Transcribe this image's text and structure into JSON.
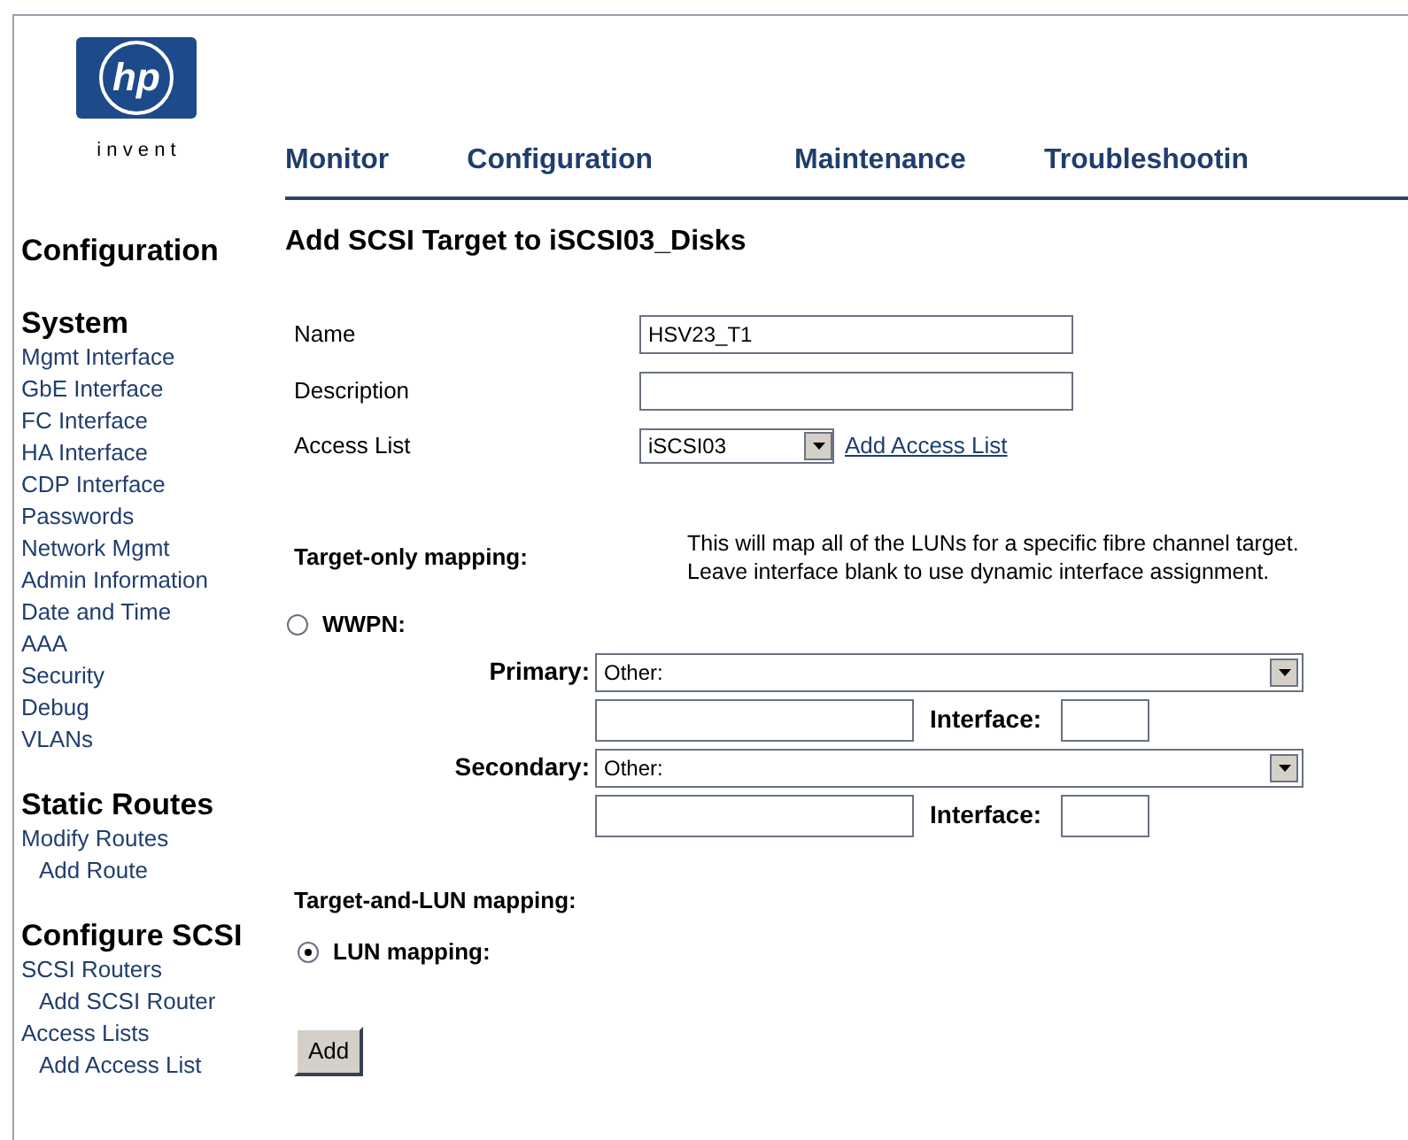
{
  "logo": {
    "mark": "hp",
    "tagline": "i n v e n t"
  },
  "nav": [
    {
      "label": "Monitor"
    },
    {
      "label": "Configuration"
    },
    {
      "label": "Maintenance"
    },
    {
      "label": "Troubleshootin"
    }
  ],
  "sidebar": {
    "title": "Configuration",
    "sections": [
      {
        "title": "System",
        "items": [
          {
            "label": "Mgmt Interface"
          },
          {
            "label": "GbE Interface"
          },
          {
            "label": "FC Interface"
          },
          {
            "label": "HA Interface"
          },
          {
            "label": "CDP Interface"
          },
          {
            "label": "Passwords"
          },
          {
            "label": "Network Mgmt"
          },
          {
            "label": "Admin Information"
          },
          {
            "label": "Date and Time"
          },
          {
            "label": "AAA"
          },
          {
            "label": "Security"
          },
          {
            "label": "Debug"
          },
          {
            "label": "VLANs"
          }
        ]
      },
      {
        "title": "Static Routes",
        "items": [
          {
            "label": "Modify Routes",
            "children": [
              {
                "label": "Add Route"
              }
            ]
          }
        ]
      },
      {
        "title": "Configure SCSI",
        "items": [
          {
            "label": "SCSI Routers",
            "children": [
              {
                "label": "Add SCSI Router"
              }
            ]
          },
          {
            "label": "Access Lists",
            "children": [
              {
                "label": "Add Access List"
              }
            ]
          }
        ]
      }
    ]
  },
  "page_title": "Add SCSI Target to iSCSI03_Disks",
  "fields": {
    "name": {
      "label": "Name",
      "value": "HSV23_T1"
    },
    "description": {
      "label": "Description"
    },
    "access_list": {
      "label": "Access List",
      "value": "iSCSI03",
      "link": "Add Access List"
    }
  },
  "target_only": {
    "label": "Target-only mapping:",
    "help": "This will map all of the LUNs for a specific fibre channel target. Leave interface blank to use dynamic interface assignment.",
    "option": {
      "label": "WWPN:",
      "selected": false
    },
    "ports": [
      {
        "label": "Primary:",
        "value": "Other:",
        "interface_label": "Interface:"
      },
      {
        "label": "Secondary:",
        "value": "Other:",
        "interface_label": "Interface:"
      }
    ]
  },
  "target_and_lun": {
    "label": "Target-and-LUN mapping:",
    "option": {
      "label": "LUN mapping:",
      "selected": true
    }
  },
  "submit": "Add"
}
